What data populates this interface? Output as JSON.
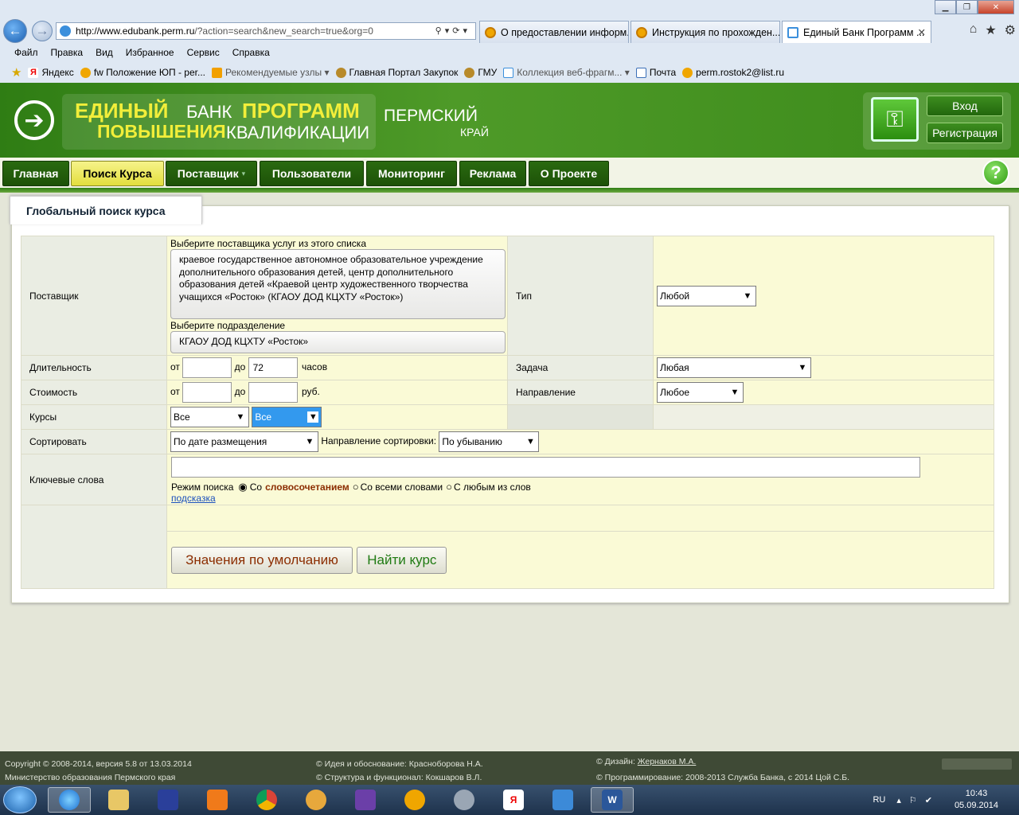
{
  "browser": {
    "address": {
      "host": "http://www.edubank.perm.ru",
      "path": "/?action=search&new_search=true&org=0"
    },
    "tabs": [
      {
        "label": "О предоставлении информ..."
      },
      {
        "label": "Инструкция по прохожден..."
      },
      {
        "label": "Единый Банк Программ ..."
      }
    ],
    "menu": [
      "Файл",
      "Правка",
      "Вид",
      "Избранное",
      "Сервис",
      "Справка"
    ],
    "favorites": [
      "Яндекс",
      "fw Положение ЮП - per...",
      "Рекомендуемые узлы",
      "Главная Портал Закупок",
      "ГМУ",
      "Коллекция веб-фрагм...",
      "Почта",
      "perm.rostok2@list.ru"
    ]
  },
  "header": {
    "logo_1": "ЕДИНЫЙ",
    "logo_2": "БАНК",
    "logo_3": "ПРОГРАММ",
    "logo_4": "ПОВЫШЕНИЯ",
    "logo_5": "КВАЛИФИКАЦИИ",
    "region_1": "ПЕРМСКИЙ",
    "region_2": "КРАЙ",
    "login": "Вход",
    "register": "Регистрация"
  },
  "nav": {
    "tabs": [
      "Главная",
      "Поиск Курса",
      "Поставщик",
      "Пользователи",
      "Мониторинг",
      "Реклама",
      "О Проекте"
    ],
    "help": "?"
  },
  "form": {
    "title": "Глобальный поиск курса",
    "provider_label": "Поставщик",
    "provider_hint": "Выберите поставщика услуг из этого списка",
    "provider_value": "краевое государственное автономное образовательное учреждение дополнительного образования детей, центр дополнительного образования детей «Краевой центр художественного творчества учащихся «Росток» (КГАОУ ДОД КЦХТУ «Росток»)",
    "division_hint": "Выберите подразделение",
    "division_value": "КГАОУ ДОД КЦХТУ «Росток»",
    "type_label": "Тип",
    "type_value": "Любой",
    "duration_label": "Длительность",
    "from": "от",
    "to": "до",
    "duration_to_value": "72",
    "hours": "часов",
    "task_label": "Задача",
    "task_value": "Любая",
    "cost_label": "Стоимость",
    "rub": "руб.",
    "direction_label": "Направление",
    "direction_value": "Любое",
    "courses_label": "Курсы",
    "courses_value_1": "Все",
    "courses_value_2": "Все",
    "sort_label": "Сортировать",
    "sort_value": "По дате размещения",
    "sort_dir_label": "Направление сортировки:",
    "sort_dir_value": "По убыванию",
    "keywords_label": "Ключевые слова",
    "search_mode_label": "Режим поиска",
    "mode_1_prefix": "Со",
    "mode_1_bold": "словосочетанием",
    "mode_2": "Со всеми словами",
    "mode_3": "С любым из слов",
    "hint_link": "подсказка",
    "defaults_button": "Значения по умолчанию",
    "find_button": "Найти курс"
  },
  "footer": {
    "copyright": "Copyright © 2008-2014, версия 5.8 от 13.03.2014",
    "ministry": "Министерство образования Пермского края",
    "idea": "© Идея и обоснование: Красноборова Н.А.",
    "structure": "© Структура и функционал: Кокшаров В.Л.",
    "design_prefix": "© Дизайн:",
    "design_name": "Жернаков М.А.",
    "programming": "© Программирование: 2008-2013 Служба Банка, с 2014 Цой С.Б."
  },
  "taskbar": {
    "lang": "RU",
    "time": "10:43",
    "date": "05.09.2014"
  },
  "colors": {
    "header_green": "#3b8a1a",
    "nav_active": "#e3de3d",
    "field_bg": "#fafad6",
    "label_bg": "#eaede3"
  }
}
